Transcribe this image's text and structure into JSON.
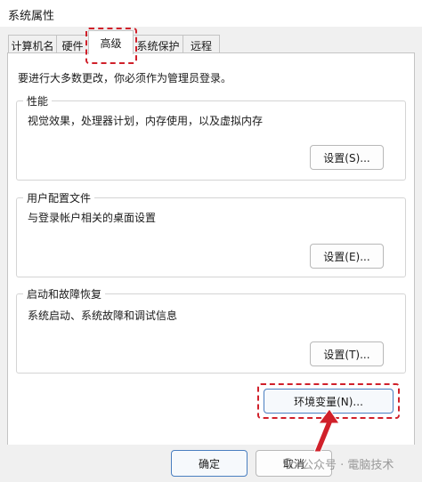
{
  "window": {
    "title": "系统属性"
  },
  "tabs": [
    {
      "label": "计算机名"
    },
    {
      "label": "硬件"
    },
    {
      "label": "高级"
    },
    {
      "label": "系统保护"
    },
    {
      "label": "远程"
    }
  ],
  "active_tab": "高级",
  "admin_note": "要进行大多数更改，你必须作为管理员登录。",
  "groups": {
    "performance": {
      "title": "性能",
      "description": "视觉效果，处理器计划，内存使用，以及虚拟内存",
      "button": "设置(S)..."
    },
    "user_profiles": {
      "title": "用户配置文件",
      "description": "与登录帐户相关的桌面设置",
      "button": "设置(E)..."
    },
    "startup_recovery": {
      "title": "启动和故障恢复",
      "description": "系统启动、系统故障和调试信息",
      "button": "设置(T)..."
    }
  },
  "env_button": "环境变量(N)...",
  "dialog_buttons": {
    "ok": "确定",
    "cancel": "取消"
  },
  "watermark": "公众号 · 電脑技术",
  "colors": {
    "highlight": "#d0202a",
    "primary_border": "#4a7fc0"
  }
}
